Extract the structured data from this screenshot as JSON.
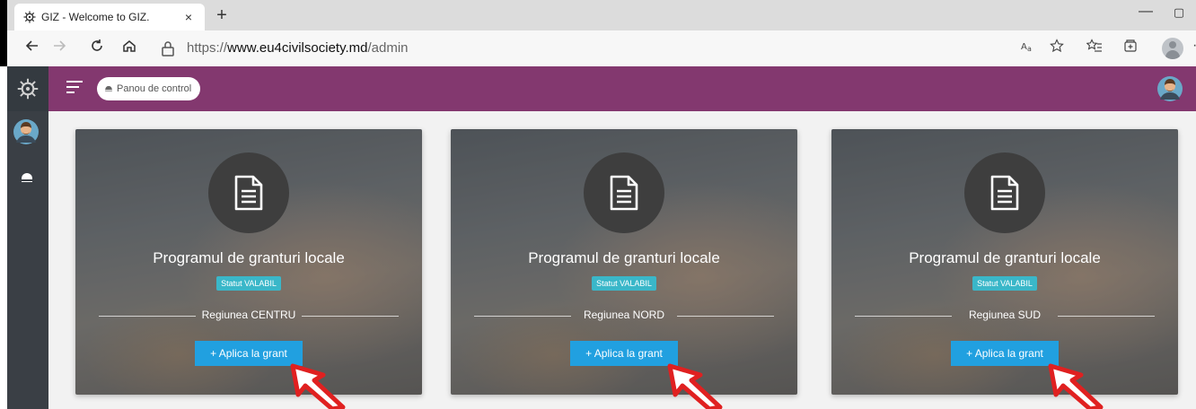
{
  "browser": {
    "tab_title": "GIZ - Welcome to GIZ.",
    "tab_close": "×",
    "new_tab": "+",
    "window_min": "—",
    "window_max": "▢",
    "url_prefix": "https://",
    "url_host": "www.eu4civilsociety.md",
    "url_path": "/admin"
  },
  "topbar": {
    "breadcrumb": "Panou de control"
  },
  "cards": [
    {
      "title": "Programul de granturi locale",
      "status": "Statut VALABIL",
      "region": "Regiunea CENTRU",
      "button": "+ Aplica la grant"
    },
    {
      "title": "Programul de granturi locale",
      "status": "Statut VALABIL",
      "region": "Regiunea NORD",
      "button": "+ Aplica la grant"
    },
    {
      "title": "Programul de granturi locale",
      "status": "Statut VALABIL",
      "region": "Regiunea SUD",
      "button": "+ Aplica la grant"
    }
  ],
  "colors": {
    "topbar": "#83386f",
    "sidebar": "#3a3f45",
    "badge": "#3ab7c9",
    "button": "#21a0e0",
    "arrow": "#e02020"
  },
  "icons": {
    "favicon": "wheel-icon",
    "sidebar_logo": "wheel-icon",
    "card_icon": "document-icon",
    "breadcrumb_icon": "dashboard-icon"
  }
}
